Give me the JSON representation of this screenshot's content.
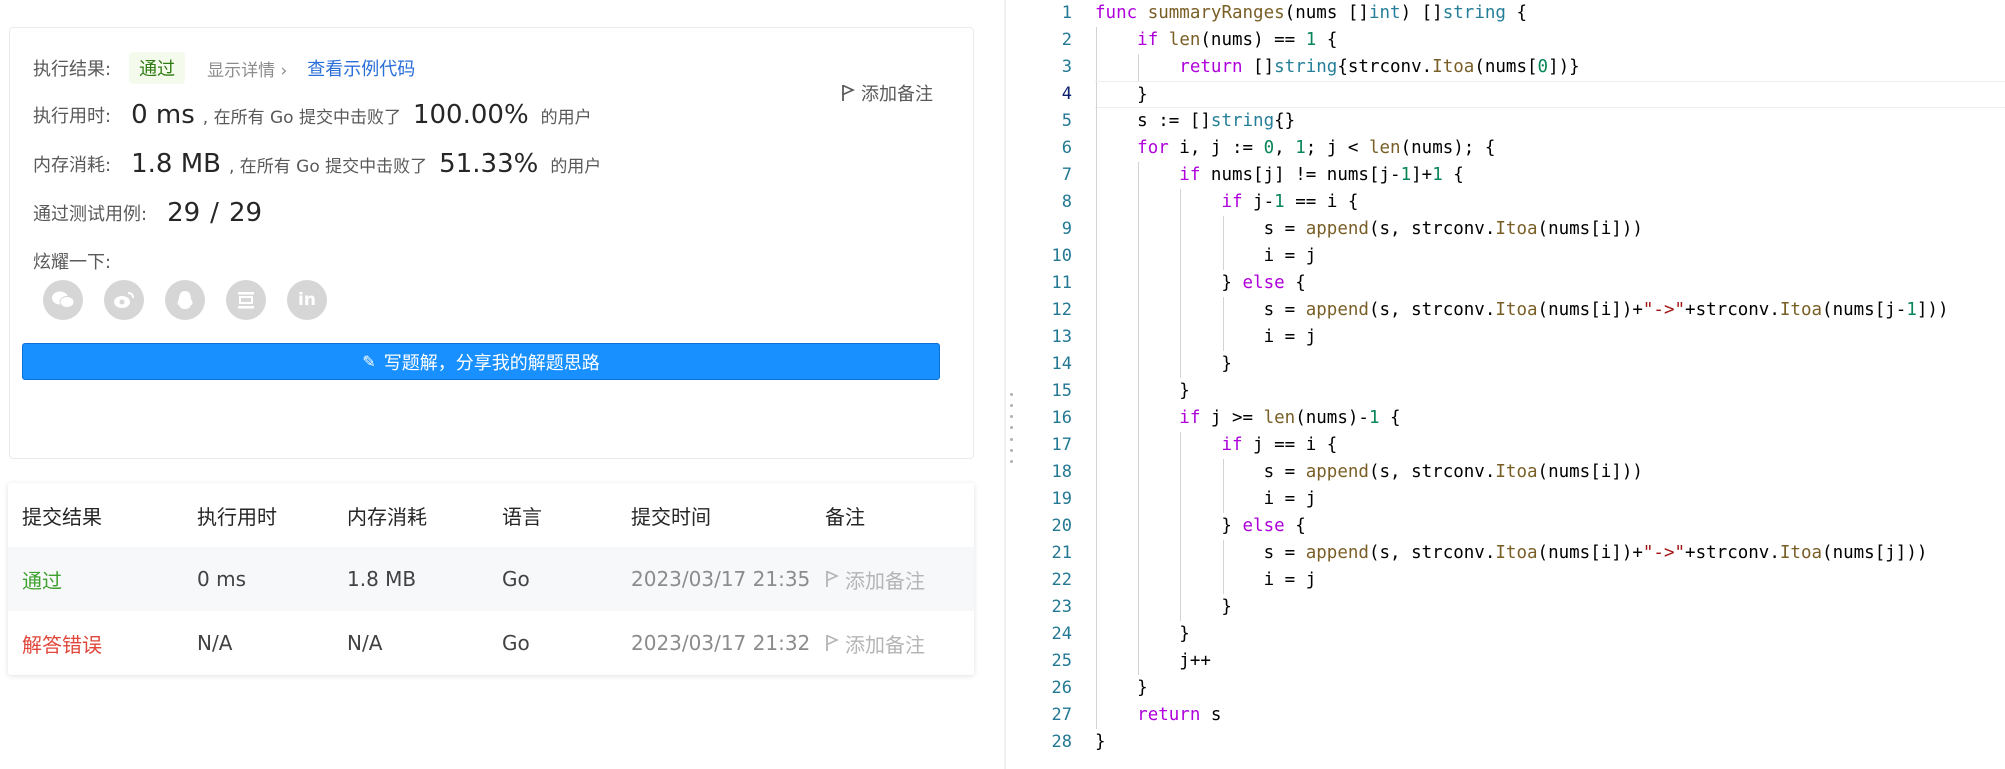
{
  "result": {
    "status_label": "执行结果:",
    "status": "通过",
    "detail_link": "显示详情",
    "sample_link": "查看示例代码",
    "add_note": "添加备注",
    "runtime_label": "执行用时:",
    "runtime_value": "0 ms",
    "runtime_text": ", 在所有 Go 提交中击败了",
    "runtime_pct": "100.00%",
    "runtime_suffix": "的用户",
    "memory_label": "内存消耗:",
    "memory_value": "1.8 MB",
    "memory_text": ", 在所有 Go 提交中击败了",
    "memory_pct": "51.33%",
    "memory_suffix": "的用户",
    "testcases_label": "通过测试用例:",
    "testcases_passed": "29",
    "testcases_sep": "/",
    "testcases_total": "29",
    "share_label": "炫耀一下:",
    "share_icons": [
      "wechat-icon",
      "weibo-icon",
      "qq-icon",
      "douban-icon",
      "linkedin-icon"
    ],
    "write_button": "写题解，分享我的解题思路"
  },
  "submissions": {
    "headers": [
      "提交结果",
      "执行用时",
      "内存消耗",
      "语言",
      "提交时间",
      "备注"
    ],
    "rows": [
      {
        "result": "通过",
        "runtime": "0 ms",
        "memory": "1.8 MB",
        "lang": "Go",
        "time": "2023/03/17 21:35",
        "note": "添加备注"
      },
      {
        "result": "解答错误",
        "runtime": "N/A",
        "memory": "N/A",
        "lang": "Go",
        "time": "2023/03/17 21:32",
        "note": "添加备注"
      }
    ]
  },
  "editor": {
    "lines": [
      "func summaryRanges(nums []int) []string {",
      "    if len(nums) == 1 {",
      "        return []string{strconv.Itoa(nums[0])}",
      "    }",
      "    s := []string{}",
      "    for i, j := 0, 1; j < len(nums); {",
      "        if nums[j] != nums[j-1]+1 {",
      "            if j-1 == i {",
      "                s = append(s, strconv.Itoa(nums[i]))",
      "                i = j",
      "            } else {",
      "                s = append(s, strconv.Itoa(nums[i])+\"->\"+strconv.Itoa(nums[j-1]))",
      "                i = j",
      "            }",
      "        }",
      "        if j >= len(nums)-1 {",
      "            if j == i {",
      "                s = append(s, strconv.Itoa(nums[i]))",
      "                i = j",
      "            } else {",
      "                s = append(s, strconv.Itoa(nums[i])+\"->\"+strconv.Itoa(nums[j]))",
      "                i = j",
      "            }",
      "        }",
      "        j++",
      "    }",
      "    return s",
      "}"
    ],
    "current_line": 4
  },
  "colors": {
    "accent": "#1890ff",
    "pass": "#3da22d",
    "fail": "#e0473a",
    "keyword": "#af00db",
    "type": "#267f99",
    "function": "#795e26",
    "number": "#098658",
    "string": "#a31515"
  }
}
